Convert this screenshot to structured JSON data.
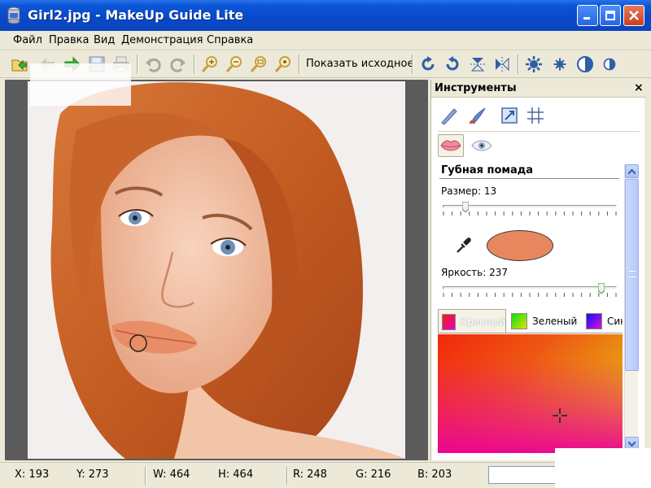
{
  "window": {
    "title": "Girl2.jpg - MakeUp Guide Lite"
  },
  "menu": {
    "items": [
      {
        "label": "Файл"
      },
      {
        "label": "Правка"
      },
      {
        "label": "Вид"
      },
      {
        "label": "Демонстрация"
      },
      {
        "label": "Справка"
      }
    ]
  },
  "toolbar": {
    "show_original_label": "Показать исходное",
    "icons": [
      "open-folder-icon",
      "back-arrow-icon",
      "forward-arrow-icon",
      "save-icon",
      "print-icon",
      "undo-icon",
      "redo-icon",
      "zoom-in-icon",
      "zoom-out-icon",
      "zoom-fit-icon",
      "zoom-actual-icon",
      "rotate-cw-icon",
      "rotate-ccw-icon",
      "flip-vertical-icon",
      "flip-horizontal-icon",
      "brightness-gear-icon",
      "small-gear-icon",
      "contrast-icon",
      "half-contrast-icon"
    ]
  },
  "panel": {
    "title": "Инструменты",
    "close_glyph": "×",
    "section_title": "Губная помада",
    "size_label": "Размер: 13",
    "size_value": 13,
    "brightness_label": "Яркость: 237",
    "brightness_value": 237,
    "color_tabs": [
      {
        "label": "Красный",
        "selected": true
      },
      {
        "label": "Зеленый",
        "selected": false
      },
      {
        "label": "Син",
        "selected": false
      }
    ],
    "swatch_color": "#E8875E"
  },
  "status": {
    "x": "X: 193",
    "y": "Y: 273",
    "w": "W: 464",
    "h": "H: 464",
    "r": "R: 248",
    "g": "G: 216",
    "b": "B: 203"
  },
  "colors": {
    "titlebar": "#0A56D8",
    "chrome": "#ECE9D8",
    "canvas_bg": "#5B5B5B",
    "lip_color": "#E8875E"
  }
}
